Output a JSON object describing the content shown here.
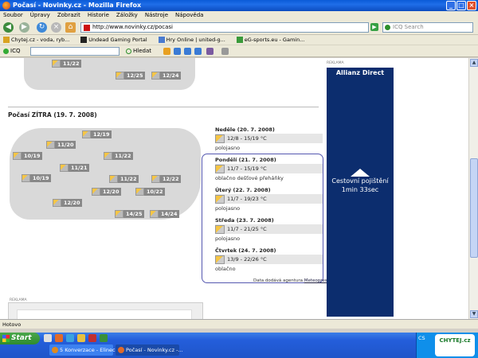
{
  "window": {
    "title": "Počasí - Novinky.cz - Mozilla Firefox"
  },
  "menu": [
    "Soubor",
    "Úpravy",
    "Zobrazit",
    "Historie",
    "Záložky",
    "Nástroje",
    "Nápověda"
  ],
  "nav": {
    "url": "http://www.novinky.cz/pocasi",
    "search_placeholder": "ICQ Search"
  },
  "bookmarks": [
    {
      "label": "Chytej.cz - voda, ryb...",
      "color": "#d9a321"
    },
    {
      "label": "Undead Gaming Portal",
      "color": "#222222"
    },
    {
      "label": "Hry Online | united-g...",
      "color": "#4a7bd0"
    },
    {
      "label": "eG-sports.eu - Gamin...",
      "color": "#3a9a3a"
    }
  ],
  "icqbar": {
    "label": "ICQ",
    "search_label": "Hledat"
  },
  "page": {
    "top_temps": [
      "11/22",
      "12/25",
      "12/24"
    ],
    "section_title": "Počasí ZÍTRA (19. 7. 2008)",
    "map_temps": [
      "12/19",
      "10/19",
      "11/20",
      "11/22",
      "11/21",
      "10/19",
      "11/22",
      "12/22",
      "12/20",
      "10/22",
      "12/20",
      "14/25",
      "14/24"
    ],
    "forecast": [
      {
        "day": "Neděle (20. 7. 2008)",
        "range": "12/8 - 15/19 °C",
        "desc": "polojasno"
      },
      {
        "day": "Pondělí (21. 7. 2008)",
        "range": "11/7 - 15/19 °C",
        "desc": "oblačno dešťové přeháňky"
      },
      {
        "day": "Úterý (22. 7. 2008)",
        "range": "11/7 - 19/23 °C",
        "desc": "polojasno"
      },
      {
        "day": "Středa (23. 7. 2008)",
        "range": "11/7 - 21/25 °C",
        "desc": "polojasno"
      },
      {
        "day": "Čtvrtek (24. 7. 2008)",
        "range": "13/9 - 22/26 °C",
        "desc": "oblačno"
      }
    ],
    "credit_prefix": "Data dodává agentura",
    "credit_link": "Meteopress",
    "reklama": "REKLAMA"
  },
  "ad": {
    "brand": "Allianz Direct",
    "message": "Cestovní pojištění 1min 33sec"
  },
  "status": {
    "text": "Hotovo"
  },
  "taskbar": {
    "start_label": "Start",
    "tasks": [
      {
        "label": "5 Konverzace - Elinec...",
        "color": "#e08a1e"
      },
      {
        "label": "Počasí - Novinky.cz -...",
        "color": "#e06a2a"
      }
    ],
    "tray_lang": "CS",
    "tray_logo": "CHYTEJ.cz"
  }
}
